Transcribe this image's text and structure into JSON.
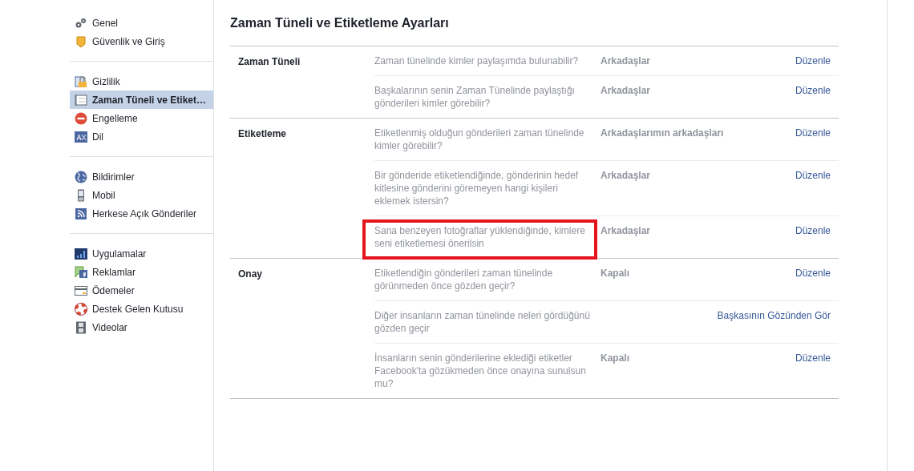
{
  "sidebar": {
    "groups": [
      [
        {
          "label": "Genel",
          "selected": false
        },
        {
          "label": "Güvenlik ve Giriş",
          "selected": false
        }
      ],
      [
        {
          "label": "Gizlilik",
          "selected": false
        },
        {
          "label": "Zaman Tüneli ve Etiket…",
          "selected": true
        },
        {
          "label": "Engelleme",
          "selected": false
        },
        {
          "label": "Dil",
          "selected": false
        }
      ],
      [
        {
          "label": "Bildirimler",
          "selected": false
        },
        {
          "label": "Mobil",
          "selected": false
        },
        {
          "label": "Herkese Açık Gönderiler",
          "selected": false
        }
      ],
      [
        {
          "label": "Uygulamalar",
          "selected": false
        },
        {
          "label": "Reklamlar",
          "selected": false
        },
        {
          "label": "Ödemeler",
          "selected": false
        },
        {
          "label": "Destek Gelen Kutusu",
          "selected": false
        },
        {
          "label": "Videolar",
          "selected": false
        }
      ]
    ]
  },
  "page_title": "Zaman Tüneli ve Etiketleme Ayarları",
  "sections": [
    {
      "title": "Zaman Tüneli",
      "rows": [
        {
          "question": "Zaman tünelinde kimler paylaşımda bulunabilir?",
          "value": "Arkadaşlar",
          "action": "Düzenle",
          "highlighted": false
        },
        {
          "question": "Başkalarının senin Zaman Tünelinde paylaştığı gönderileri kimler görebilir?",
          "value": "Arkadaşlar",
          "action": "Düzenle",
          "highlighted": false
        }
      ]
    },
    {
      "title": "Etiketleme",
      "rows": [
        {
          "question": "Etiketlenmiş olduğun gönderileri zaman tünelinde kimler görebilir?",
          "value": "Arkadaşlarımın arkadaşları",
          "action": "Düzenle",
          "highlighted": false
        },
        {
          "question": "Bir gönderide etiketlendiğinde, gönderinin hedef kitlesine gönderini göremeyen hangi kişileri eklemek istersin?",
          "value": "Arkadaşlar",
          "action": "Düzenle",
          "highlighted": false
        },
        {
          "question": "Sana benzeyen fotoğraflar yüklendiğinde, kimlere seni etiketlemesi önerilsin",
          "value": "Arkadaşlar",
          "action": "Düzenle",
          "highlighted": true
        }
      ]
    },
    {
      "title": "Onay",
      "rows": [
        {
          "question": "Etiketlendiğin gönderileri zaman tünelinde görünmeden önce gözden geçir?",
          "value": "Kapalı",
          "action": "Düzenle",
          "highlighted": false
        },
        {
          "question": "Diğer insanların zaman tünelinde neleri gördüğünü gözden geçir",
          "action": "Başkasının Gözünden Gör",
          "highlighted": false
        },
        {
          "question": "İnsanların senin gönderilerine eklediği etiketler Facebook'ta gözükmeden önce onayına sunulsun mu?",
          "value": "Kapalı",
          "action": "Düzenle",
          "highlighted": false
        }
      ]
    }
  ]
}
